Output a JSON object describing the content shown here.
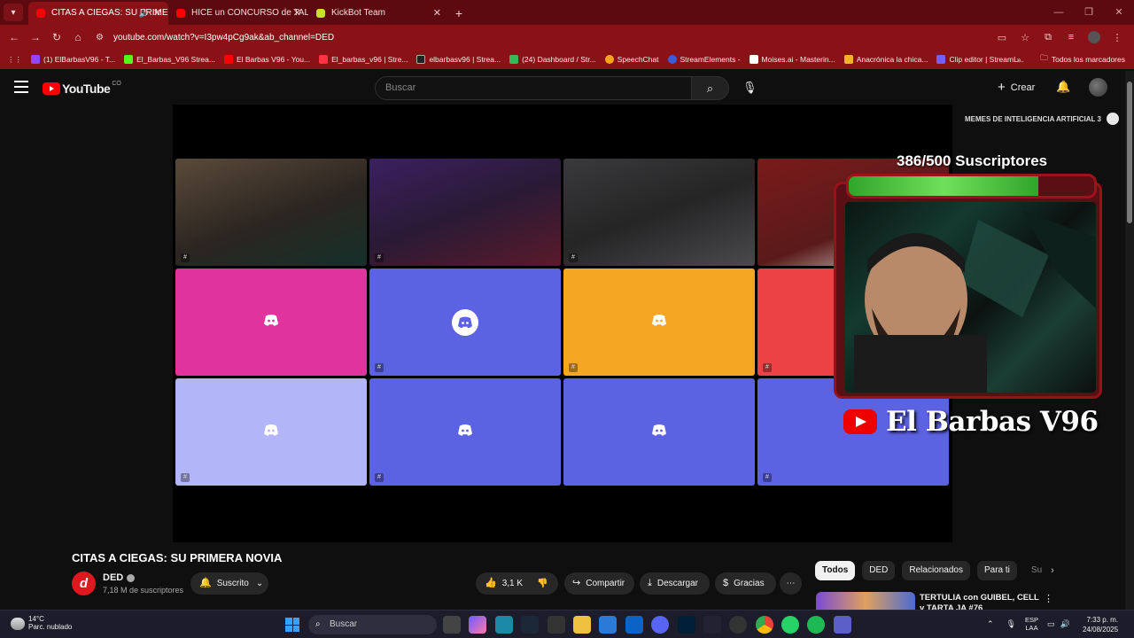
{
  "browser": {
    "tabs": [
      {
        "title": "CITAS A CIEGAS: SU PRIMER",
        "active": true,
        "color": "#ff0000"
      },
      {
        "title": "HICE un CONCURSO de TALEN",
        "active": false,
        "color": "#ff0000"
      },
      {
        "title": "KickBot Team",
        "active": false,
        "color": "#c8e02a"
      }
    ],
    "url": "youtube.com/watch?v=I3pw4pCg9ak&ab_channel=DED",
    "bookmarks": [
      {
        "label": "(1) ElBarbasV96 - T...",
        "color": "#9146ff"
      },
      {
        "label": "El_Barbas_V96 Strea...",
        "color": "#53fc18"
      },
      {
        "label": "El Barbas V96 - You...",
        "color": "#ff0000"
      },
      {
        "label": "El_barbas_v96 | Stre...",
        "color": "#ff3344"
      },
      {
        "label": "elbarbasv96 | Strea...",
        "color": "#222222"
      },
      {
        "label": "(24) Dashboard / Str...",
        "color": "#33bb55"
      },
      {
        "label": "SpeechChat",
        "color": "#f6a51a"
      },
      {
        "label": "StreamElements -",
        "color": "#3b5bdb"
      },
      {
        "label": "Moises.ai - Masterin...",
        "color": "#ffffff"
      },
      {
        "label": "Anacrónica la chica...",
        "color": "#f0b030"
      },
      {
        "label": "Clip editor | StreamL...",
        "color": "#7b5cff"
      }
    ],
    "bookmarks_more": "»",
    "all_bookmarks": "Todos los marcadores"
  },
  "youtube": {
    "logo_text": "YouTube",
    "country": "CO",
    "search_placeholder": "Buscar",
    "create_label": "Crear"
  },
  "video": {
    "tiles": [
      {
        "color": "#2b2520",
        "type": "camera"
      },
      {
        "color": "#2a1a35",
        "type": "camera"
      },
      {
        "color": "#252526",
        "type": "camera"
      },
      {
        "color": "#5a1a1a",
        "type": "camera"
      },
      {
        "color": "#e1339d",
        "type": "discord"
      },
      {
        "color": "#5c63e3",
        "type": "discord-circle"
      },
      {
        "color": "#f5a623",
        "type": "discord"
      },
      {
        "color": "#ed4245",
        "type": "discord"
      },
      {
        "color": "#b2b6f8",
        "type": "discord"
      },
      {
        "color": "#5c63e3",
        "type": "discord"
      },
      {
        "color": "#5c63e3",
        "type": "discord"
      },
      {
        "color": "#5c63e3",
        "type": "discord"
      }
    ],
    "memes_label": "MEMES DE INTELIGENCIA ARTIFICIAL 3",
    "subs_goal_text": "386/500 Suscriptores",
    "subs_progress": 0.772,
    "streamer_name": "El Barbas V96"
  },
  "below": {
    "title": "CITAS A CIEGAS: SU PRIMERA NOVIA",
    "channel": "DED",
    "subscribers": "7,18 M de suscriptores",
    "subscribed_label": "Suscrito",
    "likes": "3,1 K",
    "share_label": "Compartir",
    "download_label": "Descargar",
    "thanks_label": "Gracias",
    "chips": [
      "Todos",
      "DED",
      "Relacionados",
      "Para ti",
      "Su"
    ],
    "rec_title": "TERTULIA con GUIBEL, CELL y TARTA JA #76"
  },
  "taskbar": {
    "temp": "14°C",
    "weather": "Parc. nublado",
    "search": "Buscar",
    "lang_top": "ESP",
    "lang_bottom": "LAA",
    "time": "7:33 p. m.",
    "date": "24/08/2025"
  }
}
